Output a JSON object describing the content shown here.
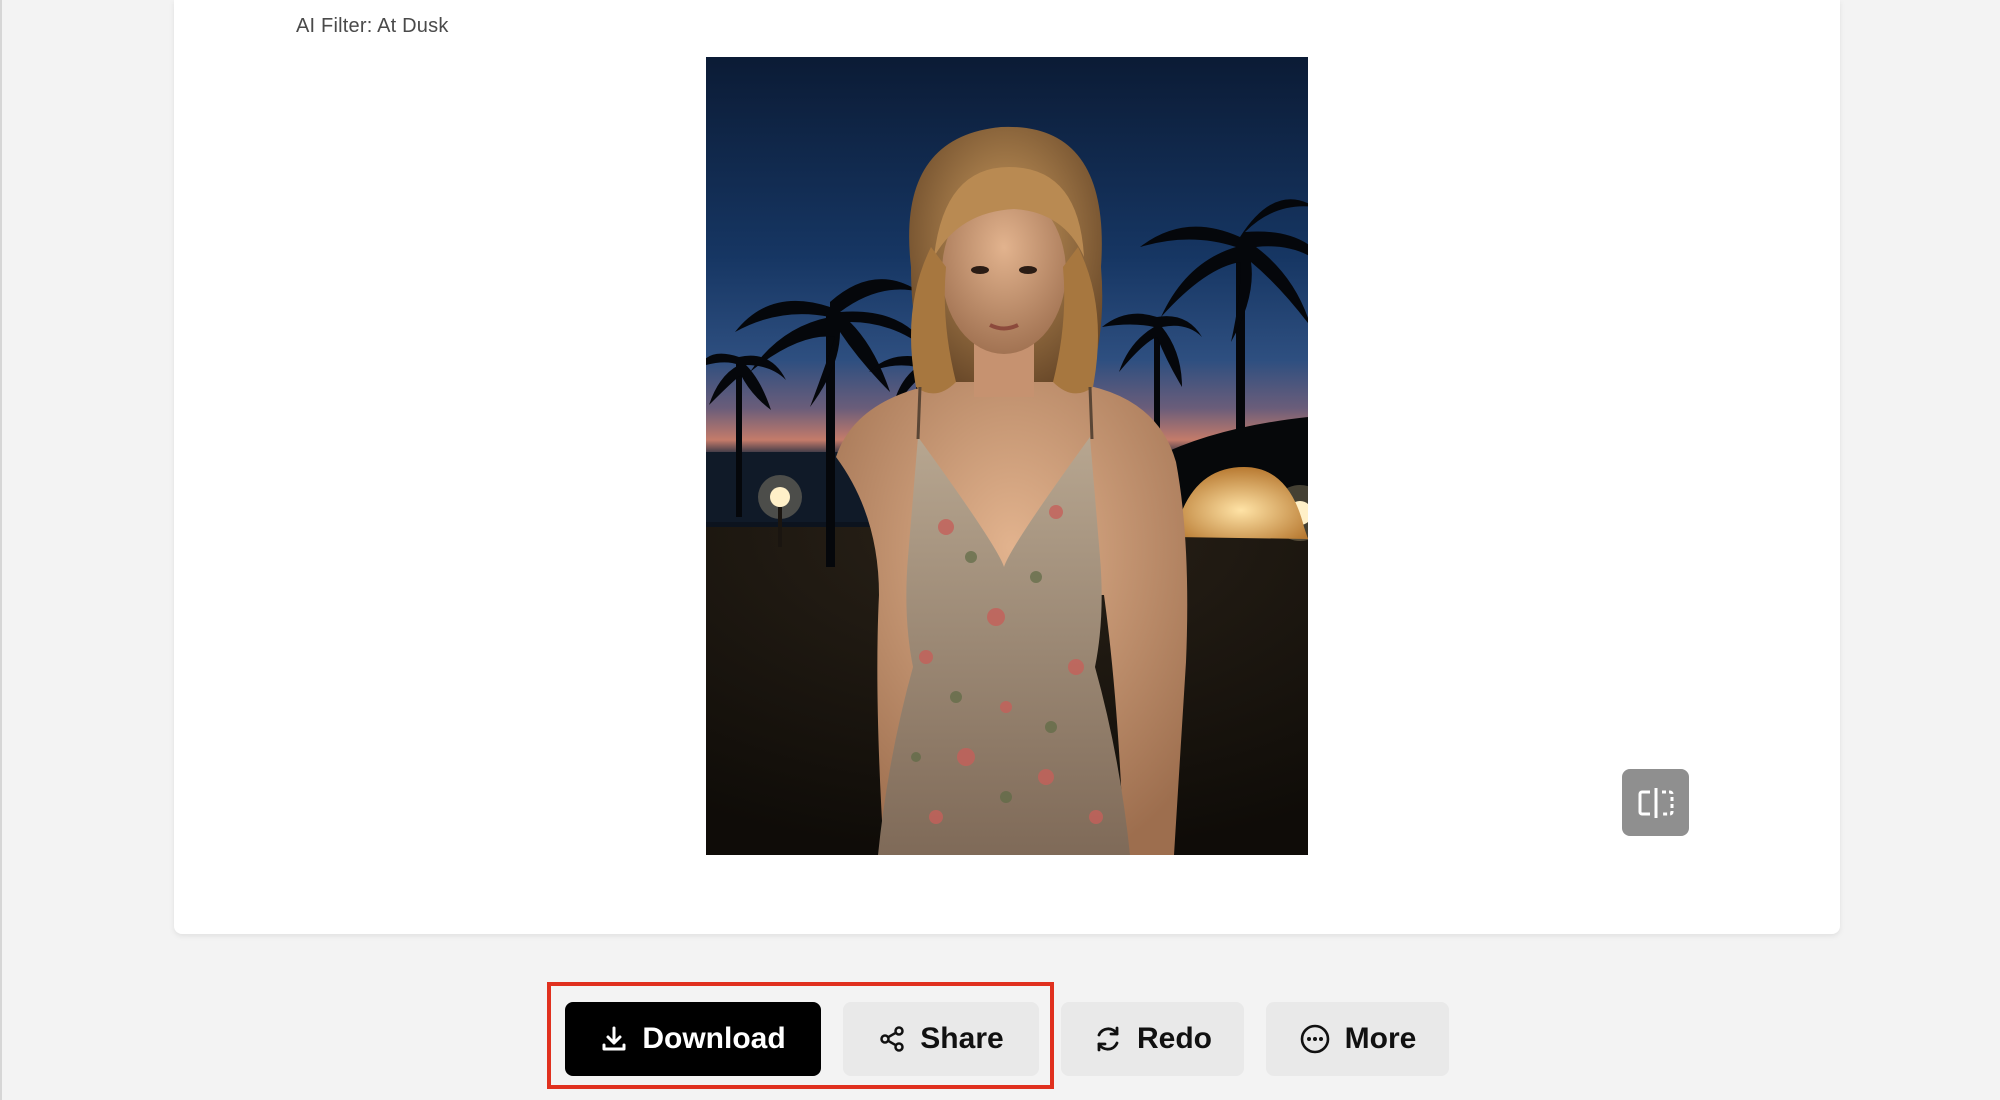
{
  "card": {
    "filter_label": "AI Filter: At Dusk"
  },
  "photo": {
    "description_icon": "portrait-photo"
  },
  "compare": {
    "icon": "compare-split-icon"
  },
  "actions": {
    "download_label": "Download",
    "share_label": "Share",
    "redo_label": "Redo",
    "more_label": "More"
  },
  "colors": {
    "highlight": "#e0301e",
    "primary_button": "#000000",
    "secondary_button": "#e9e9e9",
    "page_background": "#f3f3f3"
  }
}
